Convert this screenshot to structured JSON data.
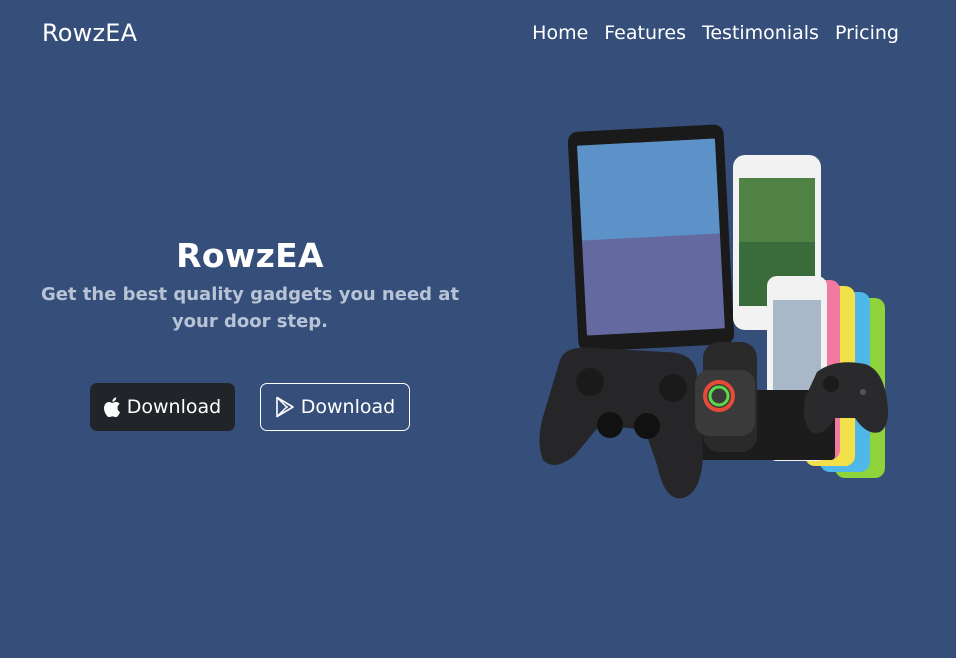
{
  "navbar": {
    "brand": "RowzEA",
    "links": [
      "Home",
      "Features",
      "Testimonials",
      "Pricing"
    ]
  },
  "hero": {
    "title": "RowzEA",
    "subtitle": "Get the best quality gadgets you need at your door step.",
    "apple_button_label": "Download",
    "play_button_label": "Download",
    "image_alt": "gadgets collage: tablet, phones, game controllers, smartwatch"
  },
  "colors": {
    "background": "#364f7a",
    "subtitle": "#b8c4d6",
    "dark_button": "#212529"
  },
  "icons": [
    "apple-icon",
    "play-store-icon"
  ]
}
